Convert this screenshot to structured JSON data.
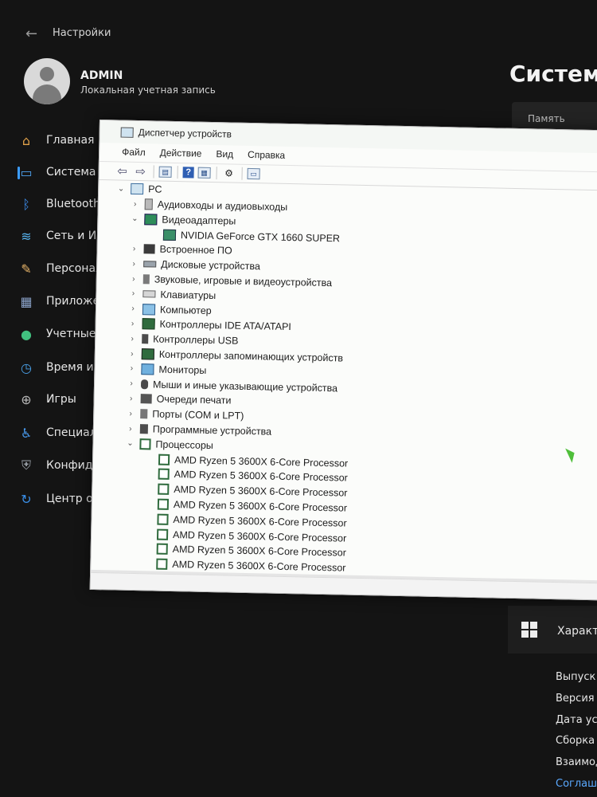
{
  "settings": {
    "back_icon": "arrow-left-icon",
    "title": "Настройки",
    "user": {
      "name": "ADMIN",
      "subtitle": "Локальная учетная запись"
    },
    "page_heading": "Система",
    "right_card_text": "Память",
    "nav": [
      {
        "label": "Главная",
        "icon": "home-icon"
      },
      {
        "label": "Система",
        "icon": "monitor-icon",
        "active": true
      },
      {
        "label": "Bluetooth и",
        "icon": "bluetooth-icon"
      },
      {
        "label": "Сеть и Инте",
        "icon": "wifi-icon"
      },
      {
        "label": "Персонализ",
        "icon": "brush-icon"
      },
      {
        "label": "Приложени",
        "icon": "apps-icon"
      },
      {
        "label": "Учетные за",
        "icon": "person-icon"
      },
      {
        "label": "Время и язы",
        "icon": "clock-globe-icon"
      },
      {
        "label": "Игры",
        "icon": "gamepad-icon"
      },
      {
        "label": "Специальн",
        "icon": "accessibility-icon"
      },
      {
        "label": "Конфиденц",
        "icon": "shield-icon"
      },
      {
        "label": "Центр обно",
        "icon": "update-icon"
      }
    ],
    "specs": {
      "title": "Характ",
      "rows": [
        "Выпуск",
        "Версия",
        "Дата уст",
        "Сборка",
        "Взаимод"
      ],
      "link": "Соглаш"
    }
  },
  "device_manager": {
    "title": "Диспетчер устройств",
    "menu": [
      "Файл",
      "Действие",
      "Вид",
      "Справка"
    ],
    "toolbar": [
      "back-arrow-icon",
      "forward-arrow-icon",
      "properties-icon",
      "help-icon",
      "view-icon",
      "scan-hardware-icon",
      "monitor-icon"
    ],
    "root": "PC",
    "tree": [
      {
        "label": "Аудиовходы и аудиовыходы",
        "icon": "audio",
        "state": "collapsed",
        "level": 1
      },
      {
        "label": "Видеоадаптеры",
        "icon": "video",
        "state": "expanded",
        "level": 1
      },
      {
        "label": "NVIDIA GeForce GTX 1660 SUPER",
        "icon": "gpu",
        "state": "leaf",
        "level": 2
      },
      {
        "label": "Встроенное ПО",
        "icon": "chip",
        "state": "collapsed",
        "level": 1
      },
      {
        "label": "Дисковые устройства",
        "icon": "disk",
        "state": "collapsed",
        "level": 1
      },
      {
        "label": "Звуковые, игровые и видеоустройства",
        "icon": "sound",
        "state": "collapsed",
        "level": 1
      },
      {
        "label": "Клавиатуры",
        "icon": "kbd",
        "state": "collapsed",
        "level": 1
      },
      {
        "label": "Компьютер",
        "icon": "comp",
        "state": "collapsed",
        "level": 1
      },
      {
        "label": "Контроллеры IDE ATA/ATAPI",
        "icon": "ide",
        "state": "collapsed",
        "level": 1
      },
      {
        "label": "Контроллеры USB",
        "icon": "usb",
        "state": "collapsed",
        "level": 1
      },
      {
        "label": "Контроллеры запоминающих устройств",
        "icon": "stor",
        "state": "collapsed",
        "level": 1
      },
      {
        "label": "Мониторы",
        "icon": "mon",
        "state": "collapsed",
        "level": 1
      },
      {
        "label": "Мыши и иные указывающие устройства",
        "icon": "mouse",
        "state": "collapsed",
        "level": 1
      },
      {
        "label": "Очереди печати",
        "icon": "print",
        "state": "collapsed",
        "level": 1
      },
      {
        "label": "Порты (COM и LPT)",
        "icon": "port",
        "state": "collapsed",
        "level": 1
      },
      {
        "label": "Программные устройства",
        "icon": "soft",
        "state": "collapsed",
        "level": 1
      },
      {
        "label": "Процессоры",
        "icon": "cpu",
        "state": "expanded",
        "level": 1
      },
      {
        "label": "AMD Ryzen 5 3600X 6-Core Processor",
        "icon": "cpu",
        "state": "leaf",
        "level": 2
      },
      {
        "label": "AMD Ryzen 5 3600X 6-Core Processor",
        "icon": "cpu",
        "state": "leaf",
        "level": 2
      },
      {
        "label": "AMD Ryzen 5 3600X 6-Core Processor",
        "icon": "cpu",
        "state": "leaf",
        "level": 2
      },
      {
        "label": "AMD Ryzen 5 3600X 6-Core Processor",
        "icon": "cpu",
        "state": "leaf",
        "level": 2
      },
      {
        "label": "AMD Ryzen 5 3600X 6-Core Processor",
        "icon": "cpu",
        "state": "leaf",
        "level": 2
      },
      {
        "label": "AMD Ryzen 5 3600X 6-Core Processor",
        "icon": "cpu",
        "state": "leaf",
        "level": 2
      },
      {
        "label": "AMD Ryzen 5 3600X 6-Core Processor",
        "icon": "cpu",
        "state": "leaf",
        "level": 2
      },
      {
        "label": "AMD Ryzen 5 3600X 6-Core Processor",
        "icon": "cpu",
        "state": "leaf",
        "level": 2
      }
    ]
  }
}
